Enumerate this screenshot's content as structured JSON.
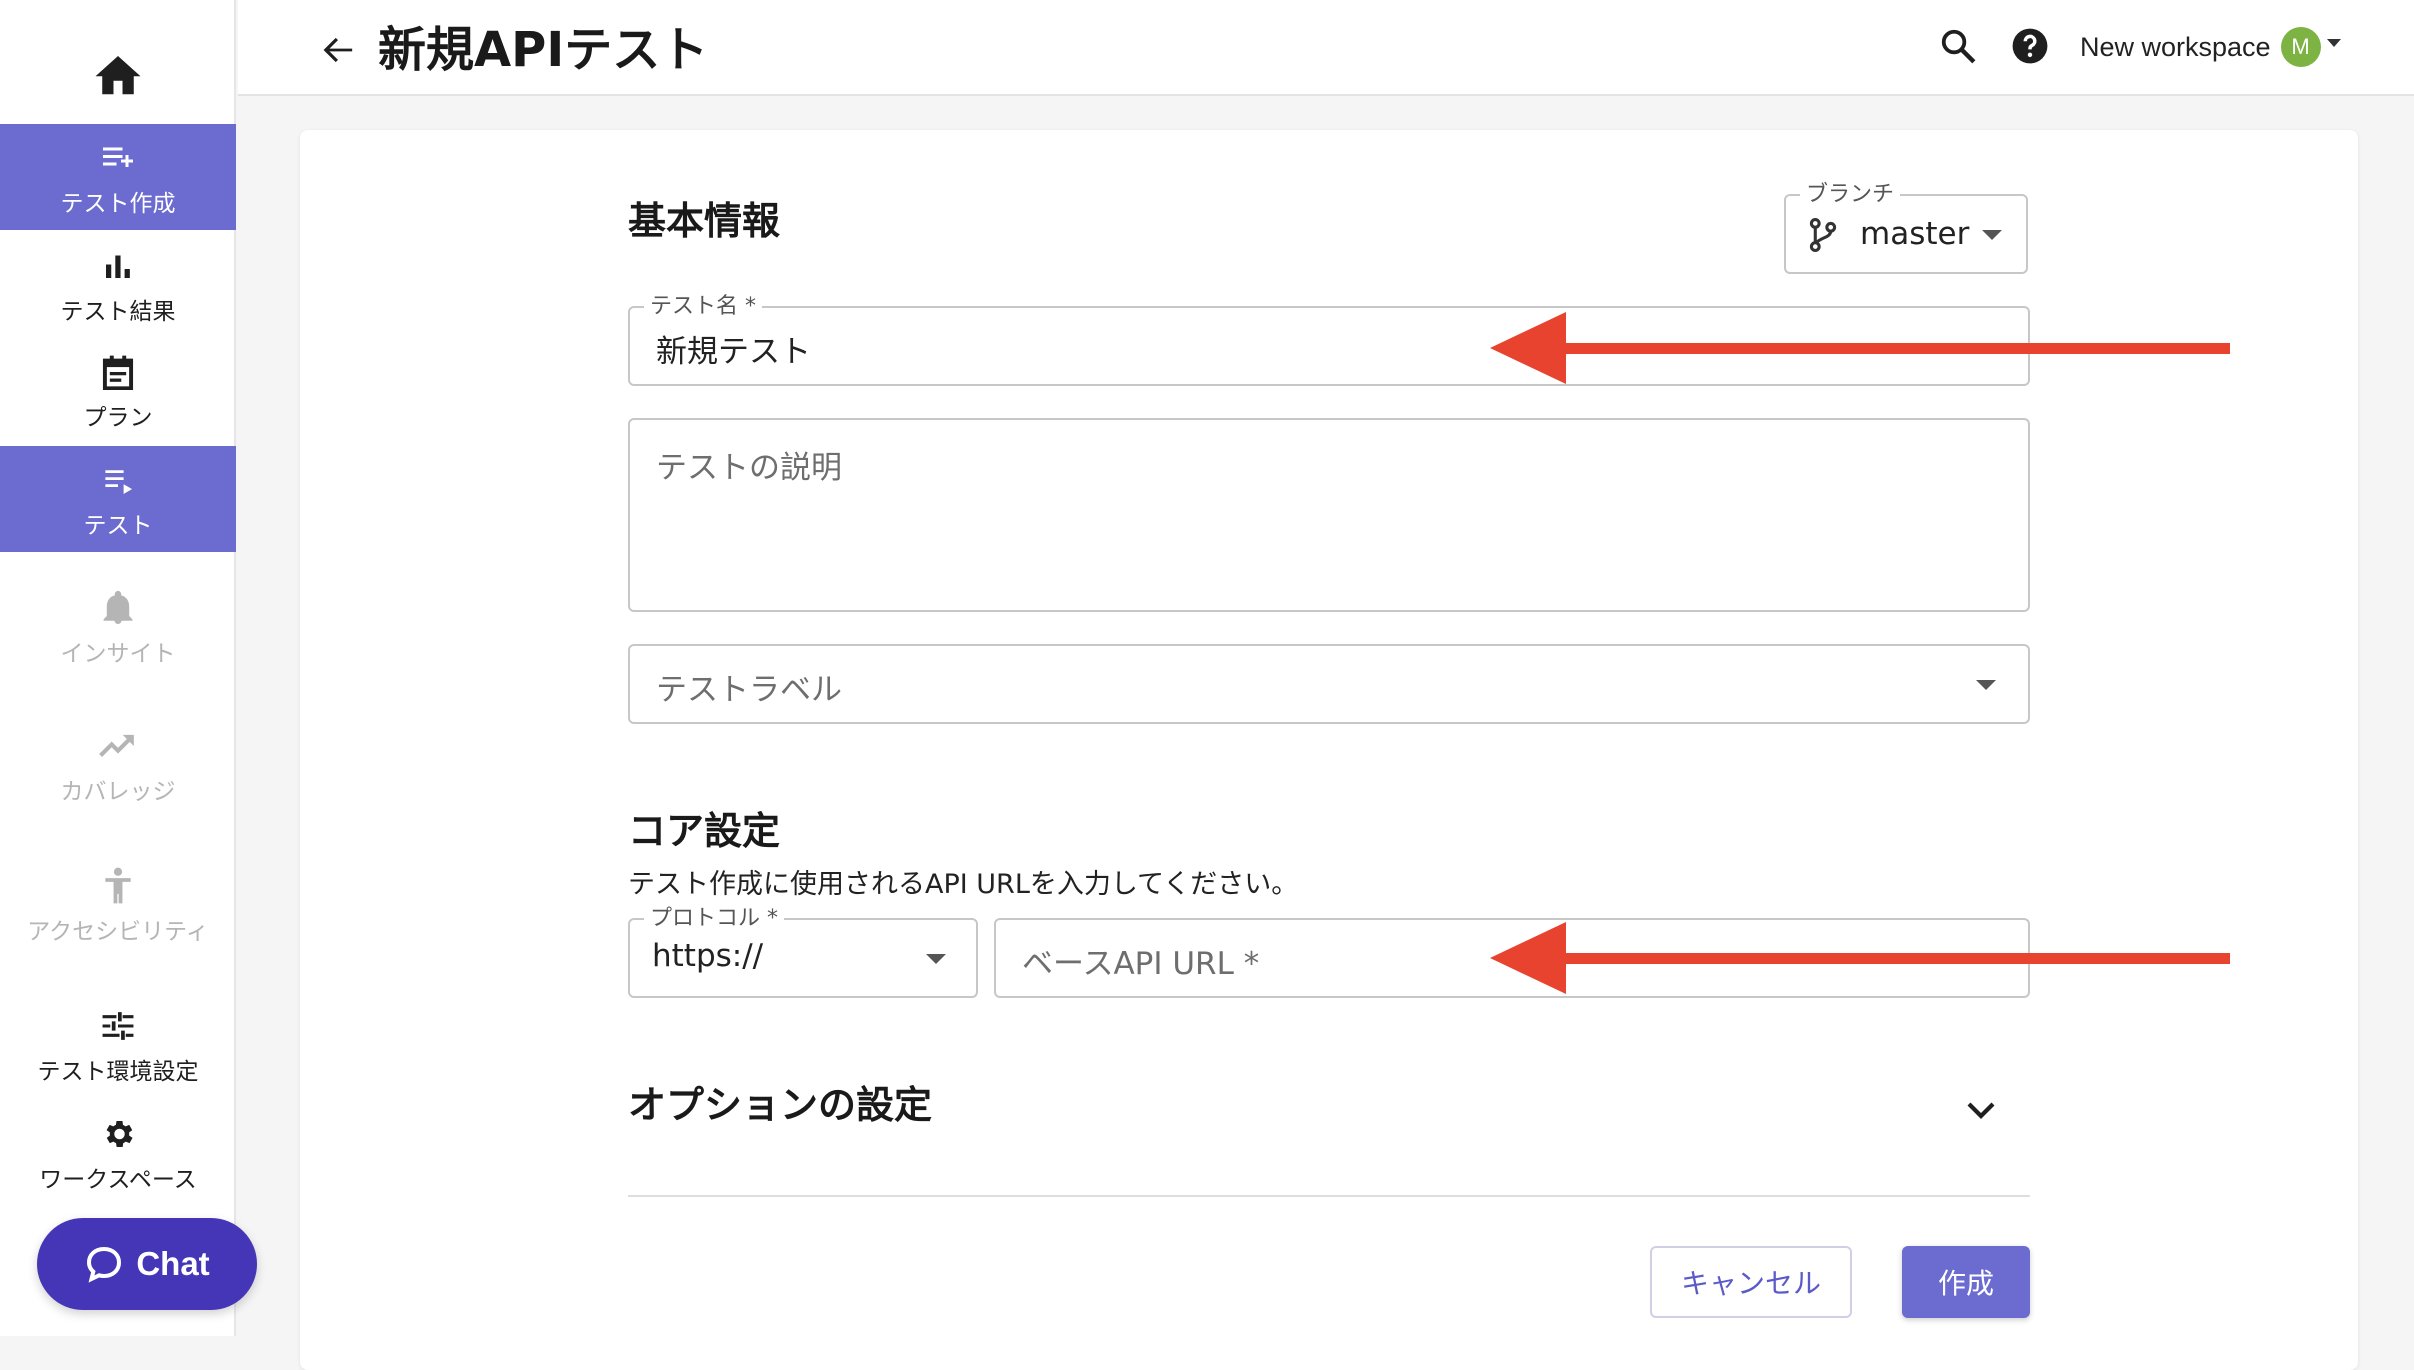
{
  "header": {
    "title": "新規APIテスト",
    "workspace_name": "New workspace",
    "avatar_initial": "M"
  },
  "sidebar": {
    "items": [
      {
        "label": "テスト作成",
        "icon": "playlist-add-icon",
        "state": "active"
      },
      {
        "label": "テスト結果",
        "icon": "bar-chart-icon",
        "state": "normal"
      },
      {
        "label": "プラン",
        "icon": "calendar-icon",
        "state": "normal"
      },
      {
        "label": "テスト",
        "icon": "playlist-play-icon",
        "state": "active"
      },
      {
        "label": "インサイト",
        "icon": "bell-icon",
        "state": "disabled"
      },
      {
        "label": "カバレッジ",
        "icon": "trending-up-icon",
        "state": "disabled"
      },
      {
        "label": "アクセシビリティ",
        "icon": "accessibility-icon",
        "state": "disabled"
      },
      {
        "label": "テスト環境設定",
        "icon": "tune-icon",
        "state": "normal"
      },
      {
        "label": "ワークスペース",
        "icon": "gear-icon",
        "state": "normal"
      }
    ],
    "chat_label": "Chat"
  },
  "basic_info": {
    "title": "基本情報",
    "branch_label": "ブランチ",
    "branch_value": "master",
    "test_name_label": "テスト名 *",
    "test_name_value": "新規テスト",
    "description_placeholder": "テストの説明",
    "label_placeholder": "テストラベル"
  },
  "core_settings": {
    "title": "コア設定",
    "hint": "テスト作成に使用されるAPI URLを入力してください。",
    "protocol_label": "プロトコル *",
    "protocol_value": "https://",
    "base_url_placeholder": "ベースAPI URL *"
  },
  "options": {
    "title": "オプションの設定"
  },
  "actions": {
    "cancel_label": "キャンセル",
    "create_label": "作成"
  },
  "colors": {
    "accent": "#6b6bd0",
    "chat": "#4436b6",
    "annotation_arrow": "#e8432e",
    "avatar": "#7cb342"
  }
}
